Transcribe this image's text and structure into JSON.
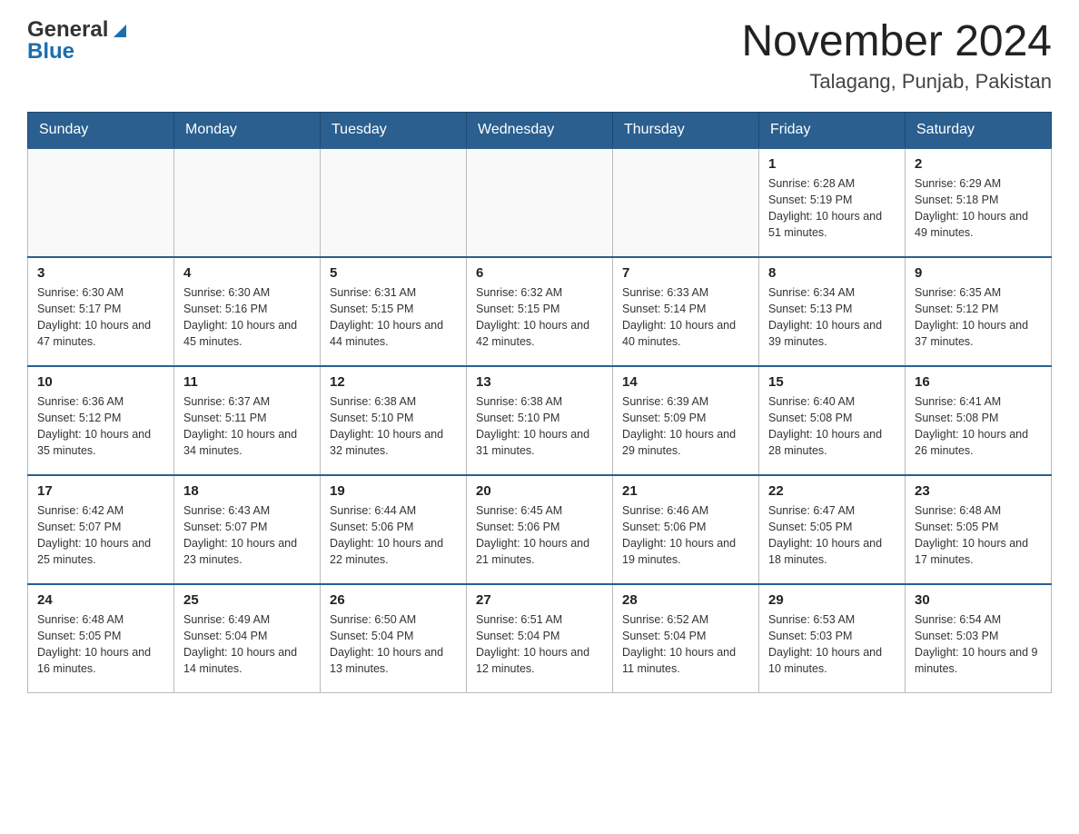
{
  "header": {
    "logo_general": "General",
    "logo_blue": "Blue",
    "month_title": "November 2024",
    "location": "Talagang, Punjab, Pakistan"
  },
  "days_of_week": [
    "Sunday",
    "Monday",
    "Tuesday",
    "Wednesday",
    "Thursday",
    "Friday",
    "Saturday"
  ],
  "weeks": [
    [
      {
        "day": "",
        "info": ""
      },
      {
        "day": "",
        "info": ""
      },
      {
        "day": "",
        "info": ""
      },
      {
        "day": "",
        "info": ""
      },
      {
        "day": "",
        "info": ""
      },
      {
        "day": "1",
        "info": "Sunrise: 6:28 AM\nSunset: 5:19 PM\nDaylight: 10 hours and 51 minutes."
      },
      {
        "day": "2",
        "info": "Sunrise: 6:29 AM\nSunset: 5:18 PM\nDaylight: 10 hours and 49 minutes."
      }
    ],
    [
      {
        "day": "3",
        "info": "Sunrise: 6:30 AM\nSunset: 5:17 PM\nDaylight: 10 hours and 47 minutes."
      },
      {
        "day": "4",
        "info": "Sunrise: 6:30 AM\nSunset: 5:16 PM\nDaylight: 10 hours and 45 minutes."
      },
      {
        "day": "5",
        "info": "Sunrise: 6:31 AM\nSunset: 5:15 PM\nDaylight: 10 hours and 44 minutes."
      },
      {
        "day": "6",
        "info": "Sunrise: 6:32 AM\nSunset: 5:15 PM\nDaylight: 10 hours and 42 minutes."
      },
      {
        "day": "7",
        "info": "Sunrise: 6:33 AM\nSunset: 5:14 PM\nDaylight: 10 hours and 40 minutes."
      },
      {
        "day": "8",
        "info": "Sunrise: 6:34 AM\nSunset: 5:13 PM\nDaylight: 10 hours and 39 minutes."
      },
      {
        "day": "9",
        "info": "Sunrise: 6:35 AM\nSunset: 5:12 PM\nDaylight: 10 hours and 37 minutes."
      }
    ],
    [
      {
        "day": "10",
        "info": "Sunrise: 6:36 AM\nSunset: 5:12 PM\nDaylight: 10 hours and 35 minutes."
      },
      {
        "day": "11",
        "info": "Sunrise: 6:37 AM\nSunset: 5:11 PM\nDaylight: 10 hours and 34 minutes."
      },
      {
        "day": "12",
        "info": "Sunrise: 6:38 AM\nSunset: 5:10 PM\nDaylight: 10 hours and 32 minutes."
      },
      {
        "day": "13",
        "info": "Sunrise: 6:38 AM\nSunset: 5:10 PM\nDaylight: 10 hours and 31 minutes."
      },
      {
        "day": "14",
        "info": "Sunrise: 6:39 AM\nSunset: 5:09 PM\nDaylight: 10 hours and 29 minutes."
      },
      {
        "day": "15",
        "info": "Sunrise: 6:40 AM\nSunset: 5:08 PM\nDaylight: 10 hours and 28 minutes."
      },
      {
        "day": "16",
        "info": "Sunrise: 6:41 AM\nSunset: 5:08 PM\nDaylight: 10 hours and 26 minutes."
      }
    ],
    [
      {
        "day": "17",
        "info": "Sunrise: 6:42 AM\nSunset: 5:07 PM\nDaylight: 10 hours and 25 minutes."
      },
      {
        "day": "18",
        "info": "Sunrise: 6:43 AM\nSunset: 5:07 PM\nDaylight: 10 hours and 23 minutes."
      },
      {
        "day": "19",
        "info": "Sunrise: 6:44 AM\nSunset: 5:06 PM\nDaylight: 10 hours and 22 minutes."
      },
      {
        "day": "20",
        "info": "Sunrise: 6:45 AM\nSunset: 5:06 PM\nDaylight: 10 hours and 21 minutes."
      },
      {
        "day": "21",
        "info": "Sunrise: 6:46 AM\nSunset: 5:06 PM\nDaylight: 10 hours and 19 minutes."
      },
      {
        "day": "22",
        "info": "Sunrise: 6:47 AM\nSunset: 5:05 PM\nDaylight: 10 hours and 18 minutes."
      },
      {
        "day": "23",
        "info": "Sunrise: 6:48 AM\nSunset: 5:05 PM\nDaylight: 10 hours and 17 minutes."
      }
    ],
    [
      {
        "day": "24",
        "info": "Sunrise: 6:48 AM\nSunset: 5:05 PM\nDaylight: 10 hours and 16 minutes."
      },
      {
        "day": "25",
        "info": "Sunrise: 6:49 AM\nSunset: 5:04 PM\nDaylight: 10 hours and 14 minutes."
      },
      {
        "day": "26",
        "info": "Sunrise: 6:50 AM\nSunset: 5:04 PM\nDaylight: 10 hours and 13 minutes."
      },
      {
        "day": "27",
        "info": "Sunrise: 6:51 AM\nSunset: 5:04 PM\nDaylight: 10 hours and 12 minutes."
      },
      {
        "day": "28",
        "info": "Sunrise: 6:52 AM\nSunset: 5:04 PM\nDaylight: 10 hours and 11 minutes."
      },
      {
        "day": "29",
        "info": "Sunrise: 6:53 AM\nSunset: 5:03 PM\nDaylight: 10 hours and 10 minutes."
      },
      {
        "day": "30",
        "info": "Sunrise: 6:54 AM\nSunset: 5:03 PM\nDaylight: 10 hours and 9 minutes."
      }
    ]
  ]
}
